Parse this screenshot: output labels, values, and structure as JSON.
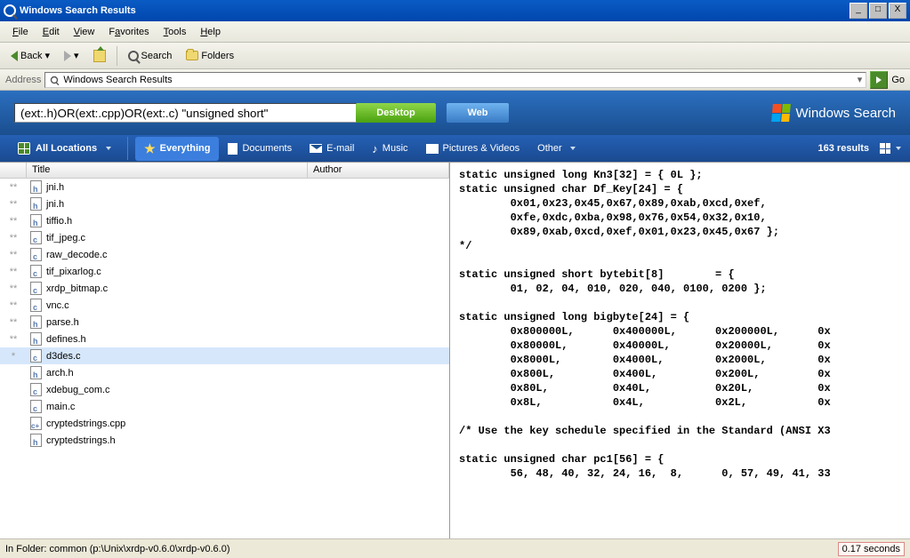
{
  "window": {
    "title": "Windows Search Results"
  },
  "menubar": {
    "file": "File",
    "edit": "Edit",
    "view": "View",
    "favorites": "Favorites",
    "tools": "Tools",
    "help": "Help"
  },
  "toolbar": {
    "back": "Back",
    "search": "Search",
    "folders": "Folders"
  },
  "address": {
    "label": "Address",
    "value": "Windows Search Results",
    "go": "Go"
  },
  "searchband": {
    "query": "(ext:.h)OR(ext:.cpp)OR(ext:.c) \"unsigned short\"",
    "desktop": "Desktop",
    "web": "Web",
    "brand": "Windows Search"
  },
  "filterbar": {
    "locations": "All Locations",
    "tabs": {
      "everything": "Everything",
      "documents": "Documents",
      "email": "E-mail",
      "music": "Music",
      "pictures": "Pictures & Videos",
      "other": "Other"
    },
    "results": "163 results"
  },
  "columns": {
    "title": "Title",
    "author": "Author"
  },
  "files": [
    {
      "idx": "**",
      "name": "jni.h",
      "type": "h"
    },
    {
      "idx": "**",
      "name": "jni.h",
      "type": "h"
    },
    {
      "idx": "**",
      "name": "tiffio.h",
      "type": "h"
    },
    {
      "idx": "**",
      "name": "tif_jpeg.c",
      "type": "c"
    },
    {
      "idx": "**",
      "name": "raw_decode.c",
      "type": "c"
    },
    {
      "idx": "**",
      "name": "tif_pixarlog.c",
      "type": "c"
    },
    {
      "idx": "**",
      "name": "xrdp_bitmap.c",
      "type": "c"
    },
    {
      "idx": "**",
      "name": "vnc.c",
      "type": "c"
    },
    {
      "idx": "**",
      "name": "parse.h",
      "type": "h"
    },
    {
      "idx": "**",
      "name": "defines.h",
      "type": "h"
    },
    {
      "idx": "*",
      "name": "d3des.c",
      "type": "c",
      "selected": true
    },
    {
      "idx": "",
      "name": "arch.h",
      "type": "h"
    },
    {
      "idx": "",
      "name": "xdebug_com.c",
      "type": "c"
    },
    {
      "idx": "",
      "name": "main.c",
      "type": "c"
    },
    {
      "idx": "",
      "name": "cryptedstrings.cpp",
      "type": "cpp"
    },
    {
      "idx": "",
      "name": "cryptedstrings.h",
      "type": "h"
    }
  ],
  "preview": "static unsigned long Kn3[32] = { 0L };\nstatic unsigned char Df_Key[24] = {\n        0x01,0x23,0x45,0x67,0x89,0xab,0xcd,0xef,\n        0xfe,0xdc,0xba,0x98,0x76,0x54,0x32,0x10,\n        0x89,0xab,0xcd,0xef,0x01,0x23,0x45,0x67 };\n*/\n\nstatic unsigned short bytebit[8]        = {\n        01, 02, 04, 010, 020, 040, 0100, 0200 };\n\nstatic unsigned long bigbyte[24] = {\n        0x800000L,      0x400000L,      0x200000L,      0x\n        0x80000L,       0x40000L,       0x20000L,       0x\n        0x8000L,        0x4000L,        0x2000L,        0x\n        0x800L,         0x400L,         0x200L,         0x\n        0x80L,          0x40L,          0x20L,          0x\n        0x8L,           0x4L,           0x2L,           0x\n\n/* Use the key schedule specified in the Standard (ANSI X3\n\nstatic unsigned char pc1[56] = {\n        56, 48, 40, 32, 24, 16,  8,      0, 57, 49, 41, 33",
  "status": {
    "folder": "In Folder:  common (p:\\Unix\\xrdp-v0.6.0\\xrdp-v0.6.0)",
    "time": "0.17 seconds"
  }
}
